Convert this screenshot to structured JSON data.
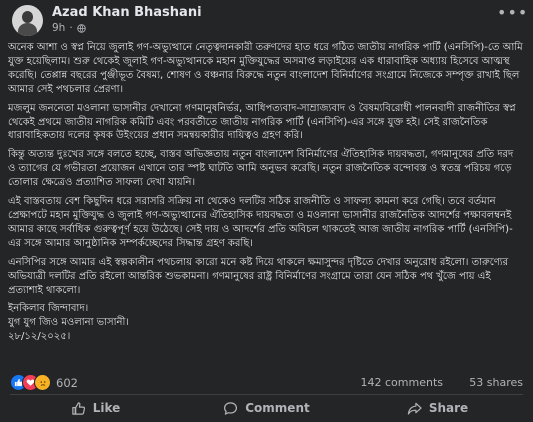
{
  "post": {
    "author": "Azad Khan Bhashani",
    "time": "9h",
    "privacy_icon": "globe-icon",
    "more_icon": "more-icon",
    "paragraphs": [
      "অনেক আশা ও স্বপ্ন নিয়ে জুলাই গণ-অভ্যুত্থানে নেতৃত্বদানকারী তরুণদের হাত ধরে গঠিত জাতীয় নাগরিক পার্টি (এনসিপি)-তে আমি যুক্ত হয়েছিলাম। শুরু থেকেই জুলাই গণ-অভ্যুত্থানকে মহান মুক্তিযুদ্ধের অসমাপ্ত লড়াইয়ের এক ধারাবাহিক অধ্যায় হিসেবে আত্মস্থ করেছি। তেপ্পান্ন বছরের পুঞ্জীভূত বৈষম্য, শোষণ ও বঞ্চনার বিরুদ্ধে নতুন বাংলাদেশ বিনির্মাণের সংগ্রামে নিজেকে সম্পৃক্ত রাখাই ছিল আমার সেই পথচলার প্রেরণা।",
      "মজলুম জননেতা মওলানা ভাসানীর দেখানো গণমানুষনির্ভর, আধিপত্যবাদ-সাম্রাজ্যবাদ ও বৈষম্যবিরোধী পালনবাদী রাজনীতির স্বপ্ন থেকেই প্রথমে জাতীয় নাগরিক কমিটি এবং পরবর্তীতে জাতীয় নাগরিক পার্টি (এনসিপি)-এর সঙ্গে যুক্ত হই। সেই রাজনৈতিক ধারাবাহিকতায় দলের কৃষক উইংয়ের প্রধান সমন্বয়কারীর দায়িত্বও গ্রহণ করি।",
      "কিন্তু অত্যন্ত দুঃখের সঙ্গে বলতে হচ্ছে, বাস্তব অভিজ্ঞতায় নতুন বাংলাদেশ বিনির্মাণের ঐতিহাসিক দায়বদ্ধতা, গণমানুষের প্রতি দরদ ও ত্যাগের যে গভীরতা প্রয়োজন এখানে তার স্পষ্ট ঘাটতি আমি অনুভব করেছি। নতুন রাজনৈতিক বন্দোবস্ত ও স্বতন্ত্র পরিচয় গড়ে তোলার ক্ষেত্রেও প্রত্যাশিত সাফল্য দেখা যায়নি।",
      "এই বাস্তবতায় বেশ কিছুদিন ধরে সরাসরি সক্রিয় না থেকেও দলটির সঠিক রাজনীতি ও সাফল্য কামনা করে গেছি। তবে বর্তমান প্রেক্ষাপটে মহান মুক্তিযুদ্ধ ও জুলাই গণ-অভ্যুত্থানের ঐতিহাসিক দায়বদ্ধতা ও মওলানা ভাসানীর রাজনৈতিক আদর্শের পক্ষাবলম্বনই আমার কাছে সর্বাধিক গুরুত্বপূর্ণ হয়ে উঠেছে। সেই দায় ও আদর্শের প্রতি অবিচল থাকতেই আজ জাতীয় নাগরিক পার্টি (এনসিপি)-এর সঙ্গে আমার আনুষ্ঠানিক সম্পর্কচ্ছেদের সিদ্ধান্ত গ্রহণ করছি।",
      "এনসিপির সঙ্গে আমার এই স্বল্পকালীন পথচলায় কারো মনে কষ্ট দিয়ে থাকলে ক্ষমাসুন্দর দৃষ্টিতে দেখার অনুরোধ রইলো। তারুণ্যের অভিযাত্রী দলটির প্রতি রইলো আন্তরিক শুভকামনা। গণমানুষের রাষ্ট্র বিনির্মাণের সংগ্রামে তারা যেন সঠিক পথ খুঁজে পায় এই প্রত্যাশাই থাকলো।"
    ],
    "signature": {
      "slogan": "ইনকিলাব জিন্দাবাদ।",
      "tagline": "যুগ যুগ জিও মওলানা ভাসানী।",
      "date": "২৮/১২/২০২৫।"
    },
    "stats": {
      "reaction_icons": [
        "like-icon",
        "love-icon",
        "sad-icon"
      ],
      "reaction_count": "602",
      "comments": "142 comments",
      "shares": "53 shares"
    },
    "actions": {
      "like_label": "Like",
      "comment_label": "Comment",
      "share_label": "Share"
    },
    "colors": {
      "background": "#242526",
      "text": "#e4e6eb",
      "secondary_text": "#b0b3b8",
      "like_blue": "#1877f2",
      "love_red": "#f33e58",
      "sad_yellow": "#f7b125"
    }
  }
}
